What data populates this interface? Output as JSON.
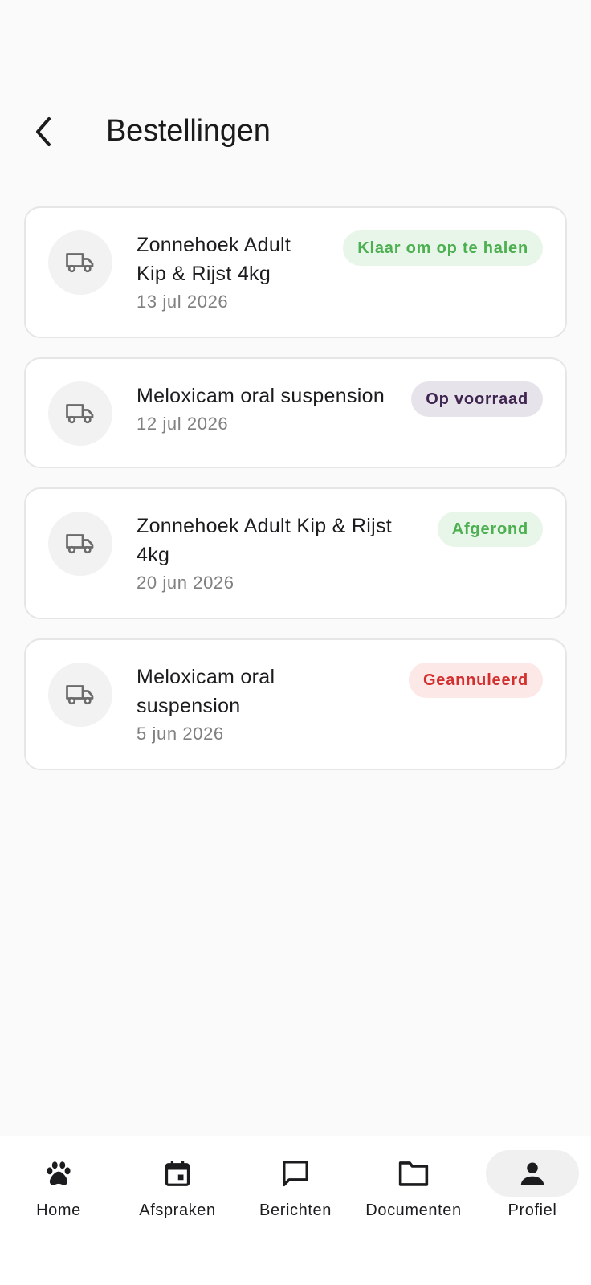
{
  "header": {
    "back_icon": "chevron-left-icon",
    "title": "Bestellingen"
  },
  "orders": [
    {
      "name_line1": "Zonnehoek Adult",
      "name_line2": "Kip & Rijst 4kg",
      "date": "13 jul 2026",
      "status": "Klaar om op te halen",
      "status_color": "#4caf50",
      "icon": "truck-icon"
    },
    {
      "name_line1": "Meloxicam oral suspension",
      "name_line2": "",
      "date": "12 jul 2026",
      "status": "Op voorraad",
      "status_color": "#3f2550",
      "icon": "truck-icon"
    },
    {
      "name_line1": "Zonnehoek Adult Kip & Rijst",
      "name_line2": "4kg",
      "date": "20 jun 2026",
      "status": "Afgerond",
      "status_color": "#4caf50",
      "icon": "truck-icon"
    },
    {
      "name_line1": "Meloxicam oral",
      "name_line2": "suspension",
      "date": "5 jun 2026",
      "status": "Geannuleerd",
      "status_color": "#d32f2f",
      "icon": "truck-icon"
    }
  ],
  "nav": {
    "items": [
      {
        "label": "Home",
        "icon": "paw-icon"
      },
      {
        "label": "Afspraken",
        "icon": "calendar-icon"
      },
      {
        "label": "Berichten",
        "icon": "message-icon"
      },
      {
        "label": "Documenten",
        "icon": "folder-icon"
      },
      {
        "label": "Profiel",
        "icon": "person-icon"
      }
    ],
    "active": "Profiel"
  }
}
